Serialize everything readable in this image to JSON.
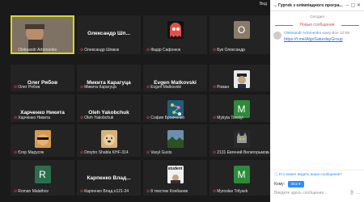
{
  "gallery": {
    "view_label": "Вид",
    "rows": [
      [
        {
          "kind": "video",
          "label": "Oleksandr Artomenko",
          "active": true
        },
        {
          "kind": "name",
          "bigname": "Олександр Шп...",
          "label": "Олександр Шпаюк"
        },
        {
          "kind": "pacman",
          "label": "Фадір Сафонюк"
        },
        {
          "kind": "letter",
          "letter": "O",
          "bg": "#8a7a6a",
          "label": "Бук Олександр"
        }
      ],
      [
        {
          "kind": "name",
          "bigname": "Олег Рябов",
          "label": "Олег Рябов"
        },
        {
          "kind": "name",
          "bigname": "Микита Карагуца",
          "label": "Микита Карагуца"
        },
        {
          "kind": "name",
          "bigname": "Evgen Matkovski",
          "label": "Evgen Matkovski"
        },
        {
          "kind": "police",
          "label": "Роман"
        }
      ],
      [
        {
          "kind": "name",
          "bigname": "Харченко Никита",
          "label": "Харченко Никита"
        },
        {
          "kind": "name",
          "bigname": "Oleh Yakobchuk",
          "label": "Oleh Yakobchuk"
        },
        {
          "kind": "molecule",
          "label": "София Бровченко"
        },
        {
          "kind": "letter",
          "letter": "M",
          "bg": "#2d8a3a",
          "label": "Mykyta Tovstyi"
        }
      ],
      [
        {
          "kind": "sunglasses",
          "label": "Єгор Марусяк"
        },
        {
          "kind": "dog",
          "label": "Dmytro Shabla KHF-314"
        },
        {
          "kind": "landscape",
          "label": "Vasyl Gusts"
        },
        {
          "kind": "cat",
          "label": "2131 Евгений Велигорьмовь"
        }
      ],
      [
        {
          "kind": "letter",
          "letter": "R",
          "bg": "#2b6e4e",
          "label": "Roman Malathov"
        },
        {
          "kind": "name",
          "bigname": "Карпенко Влад...",
          "label": "Карпенко Влад e121-24"
        },
        {
          "kind": "student",
          "student_text": "student",
          "label": "8 текстюк Клебанов"
        },
        {
          "kind": "letter",
          "letter": "M",
          "bg": "#2d8a3a",
          "label": "Myroslav Trilyack"
        }
      ]
    ]
  },
  "chat": {
    "title": "Гуртеk з олімпіадного програ...",
    "today": "Сегодня",
    "new_messages": "Новые сообщения",
    "message": {
      "sender": "Oleksandr Artomenko",
      "to": "кому Все 12:06",
      "link": "https://t.me/AlgoSaturdayGroup"
    },
    "hint": "Кто может видеть ваши сообщения?",
    "to_label": "Кому:",
    "to_value": "Все",
    "input_placeholder": "Введите здесь сообщение..."
  },
  "colors": {
    "accent": "#2d8cff",
    "active_speaker": "#d6d82a",
    "mic_muted": "#e0504a"
  }
}
